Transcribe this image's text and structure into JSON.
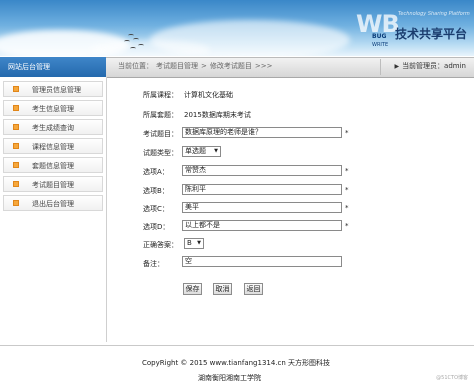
{
  "banner": {
    "logo_letters": "WB",
    "logo_subtitle": "Technology Sharing Platform",
    "logo_main": "技术共享平台",
    "logo_bug": "BUG",
    "logo_write": "WRITE"
  },
  "sidebar": {
    "title": "网站后台管理",
    "items": [
      {
        "label": "管理员信息管理"
      },
      {
        "label": "考生信息管理"
      },
      {
        "label": "考生成绩查询"
      },
      {
        "label": "课程信息管理"
      },
      {
        "label": "套题信息管理"
      },
      {
        "label": "考试题目管理"
      },
      {
        "label": "退出后台管理"
      }
    ]
  },
  "breadcrumb": {
    "prefix": "当前位置：",
    "level1": "考试题目管理",
    "sep": ">",
    "level2": "修改考试题目",
    "tail": ">>>"
  },
  "admin": {
    "text": "当前管理员：admin"
  },
  "form": {
    "course_label": "所属课程：",
    "course_value": "计算机文化基础",
    "set_label": "所属套题：",
    "set_value": "2015数据库期末考试",
    "question_label": "考试题目：",
    "question_value": "数据库原理的老师是谁？",
    "type_label": "试题类型：",
    "type_value": "单选题",
    "optA_label": "选项A：",
    "optA_value": "常赞杰",
    "optB_label": "选项B：",
    "optB_value": "陈利平",
    "optC_label": "选项C：",
    "optC_value": "美平",
    "optD_label": "选项D：",
    "optD_value": "以上都不是",
    "answer_label": "正确答案：",
    "answer_value": "B",
    "note_label": "备注：",
    "note_value": "空",
    "required_mark": "*"
  },
  "buttons": {
    "save": "保存",
    "cancel": "取消",
    "back": "返回"
  },
  "footer": {
    "copyright": "CopyRight © 2015 www.tianfang1314.cn 天方形图科技",
    "school": "湖南衡阳湘南工学院",
    "watermark": "@51CTO博客"
  }
}
